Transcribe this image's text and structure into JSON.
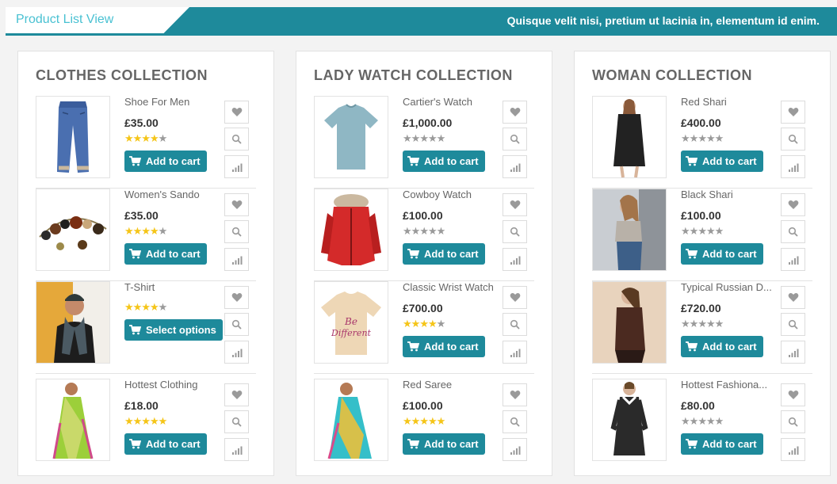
{
  "header": {
    "tab_label": "Product List View",
    "tagline": "Quisque velit nisi, pretium ut lacinia in, elementum id enim."
  },
  "colors": {
    "accent": "#1e8a9b",
    "star_on": "#f5c518",
    "star_off": "#9a9a9a"
  },
  "panels": [
    {
      "title": "CLOTHES COLLECTION",
      "items": [
        {
          "name": "Shoe For Men",
          "price": "£35.00",
          "rating": 4,
          "button": "Add to cart",
          "image": "jeans"
        },
        {
          "name": "Women's Sando",
          "price": "£35.00",
          "rating": 4,
          "button": "Add to cart",
          "image": "bracelet"
        },
        {
          "name": "T-Shirt",
          "price": "",
          "rating": 4,
          "button": "Select options",
          "image": "man-scarf"
        },
        {
          "name": "Hottest Clothing",
          "price": "£18.00",
          "rating": 5,
          "button": "Add to cart",
          "image": "green-saree"
        }
      ]
    },
    {
      "title": "LADY WATCH COLLECTION",
      "items": [
        {
          "name": "Cartier's Watch",
          "price": "£1,000.00",
          "rating": 0,
          "button": "Add to cart",
          "image": "tshirt-blue"
        },
        {
          "name": "Cowboy Watch",
          "price": "£100.00",
          "rating": 0,
          "button": "Add to cart",
          "image": "red-jacket"
        },
        {
          "name": "Classic Wrist Watch",
          "price": "£700.00",
          "rating": 4,
          "button": "Add to cart",
          "image": "tshirt-beige"
        },
        {
          "name": "Red Saree",
          "price": "£100.00",
          "rating": 5,
          "button": "Add to cart",
          "image": "teal-saree"
        }
      ]
    },
    {
      "title": "WOMAN COLLECTION",
      "items": [
        {
          "name": "Red Shari",
          "price": "£400.00",
          "rating": 0,
          "button": "Add to cart",
          "image": "woman-black-coat"
        },
        {
          "name": "Black Shari",
          "price": "£100.00",
          "rating": 0,
          "button": "Add to cart",
          "image": "woman-grey"
        },
        {
          "name": "Typical Russian D...",
          "price": "£720.00",
          "rating": 0,
          "button": "Add to cart",
          "image": "woman-brown-top"
        },
        {
          "name": "Hottest Fashiona...",
          "price": "£80.00",
          "rating": 0,
          "button": "Add to cart",
          "image": "black-dress"
        }
      ]
    }
  ]
}
